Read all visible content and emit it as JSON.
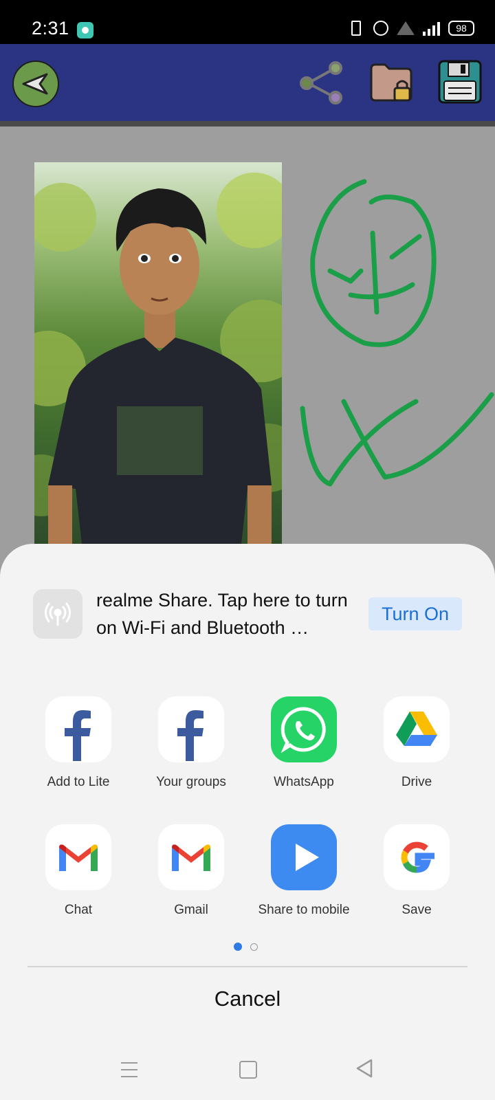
{
  "status_bar": {
    "time": "2:31",
    "battery": "98",
    "icons": [
      "app-icon",
      "vibrate-icon",
      "alarm-icon",
      "wifi-icon",
      "signal-icon",
      "battery-icon"
    ]
  },
  "toolbar": {
    "color": "#2b3483",
    "buttons": [
      "back-icon",
      "share-icon",
      "secure-folder-icon",
      "save-icon"
    ]
  },
  "share_sheet": {
    "realme_share": {
      "text": "realme Share. Tap here to turn on Wi-Fi and Bluetooth …",
      "button_label": "Turn On",
      "accent": "#1a6fd6"
    },
    "apps": [
      {
        "label": "Add to Lite",
        "icon": "facebook-icon"
      },
      {
        "label": "Your groups",
        "icon": "facebook-icon"
      },
      {
        "label": "WhatsApp",
        "icon": "whatsapp-icon"
      },
      {
        "label": "Drive",
        "icon": "google-drive-icon"
      },
      {
        "label": "Chat",
        "icon": "gmail-icon"
      },
      {
        "label": "Gmail",
        "icon": "gmail-icon"
      },
      {
        "label": "Share to mobile",
        "icon": "play-icon"
      },
      {
        "label": "Save",
        "icon": "google-icon"
      }
    ],
    "page_indicator": {
      "current": 1,
      "total": 2
    },
    "cancel_label": "Cancel"
  },
  "nav_bar": {
    "buttons": [
      "menu-icon",
      "home-icon",
      "back-icon"
    ]
  }
}
